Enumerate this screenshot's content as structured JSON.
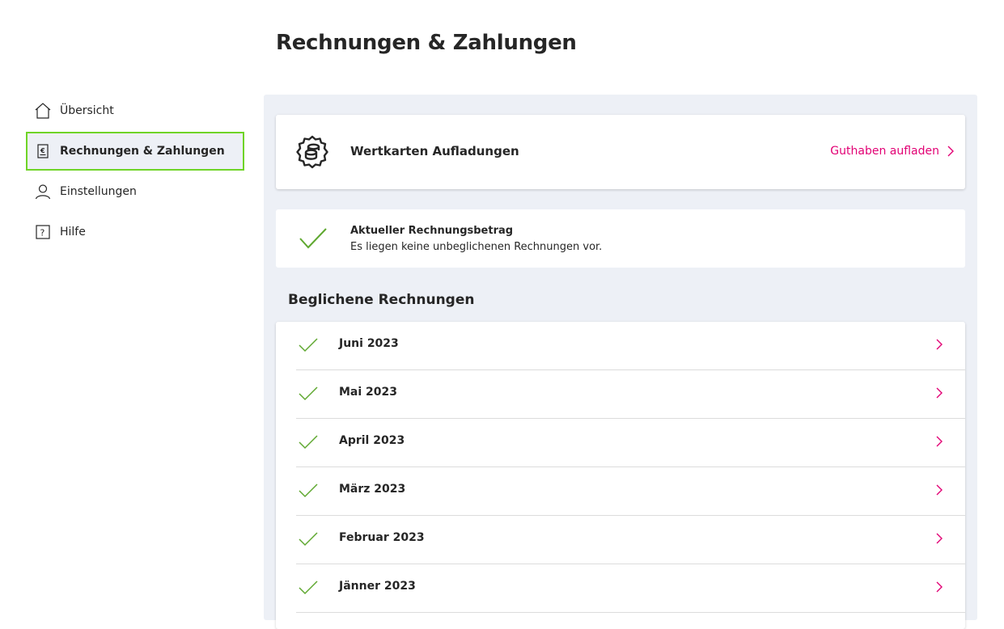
{
  "page": {
    "title": "Rechnungen & Zahlungen"
  },
  "sidebar": {
    "items": [
      {
        "label": "Übersicht",
        "icon": "home-icon",
        "active": false
      },
      {
        "label": "Rechnungen & Zahlungen",
        "icon": "invoice-euro-icon",
        "active": true
      },
      {
        "label": "Einstellungen",
        "icon": "user-icon",
        "active": false
      },
      {
        "label": "Hilfe",
        "icon": "help-icon",
        "active": false
      }
    ]
  },
  "topup": {
    "icon": "coins-icon",
    "label": "Wertkarten Aufladungen",
    "action_label": "Guthaben aufladen"
  },
  "current_bill": {
    "title": "Aktueller Rechnungsbetrag",
    "text": "Es liegen keine unbeglichenen Rechnungen vor."
  },
  "paid_bills": {
    "title": "Beglichene Rechnungen",
    "items": [
      {
        "label": "Juni 2023"
      },
      {
        "label": "Mai 2023"
      },
      {
        "label": "April 2023"
      },
      {
        "label": "März 2023"
      },
      {
        "label": "Februar 2023"
      },
      {
        "label": "Jänner 2023"
      }
    ]
  },
  "colors": {
    "accent": "#e20074",
    "check": "#5fa830",
    "active_border": "#6fd427",
    "panel_bg": "#edf0f6"
  }
}
